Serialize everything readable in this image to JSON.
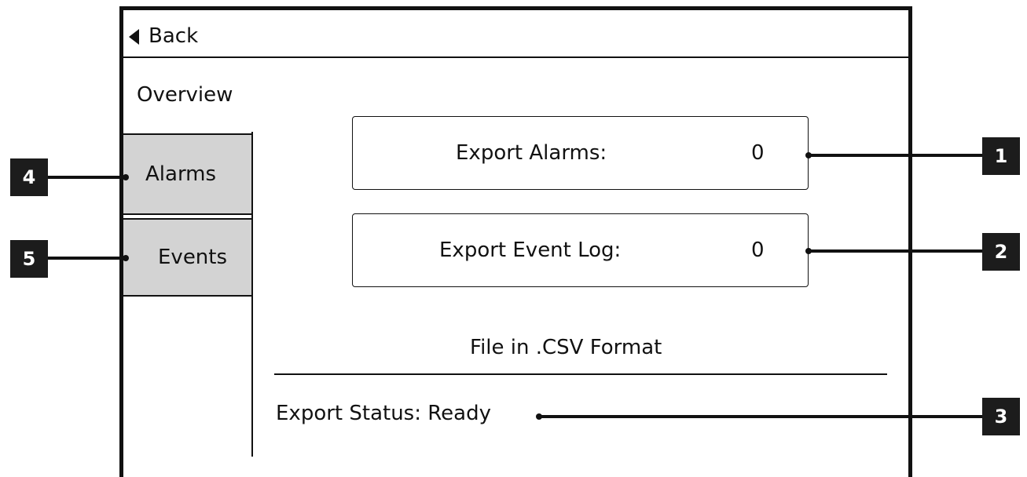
{
  "header": {
    "back_label": "Back",
    "back_icon": "back-arrow-icon"
  },
  "sidebar": {
    "section_label": "Overview",
    "tabs": [
      {
        "label": "Alarms"
      },
      {
        "label": "Events"
      }
    ]
  },
  "main": {
    "export_alarms": {
      "label": "Export Alarms:",
      "value": "0"
    },
    "export_event_log": {
      "label": "Export Event Log:",
      "value": "0"
    },
    "format_note": "File in .CSV Format",
    "status": "Export Status: Ready"
  },
  "callouts": [
    "1",
    "2",
    "3",
    "4",
    "5"
  ],
  "colors": {
    "tab_background": "#d3d3d3",
    "callout_background": "#1c1c1c",
    "line": "#111111"
  }
}
